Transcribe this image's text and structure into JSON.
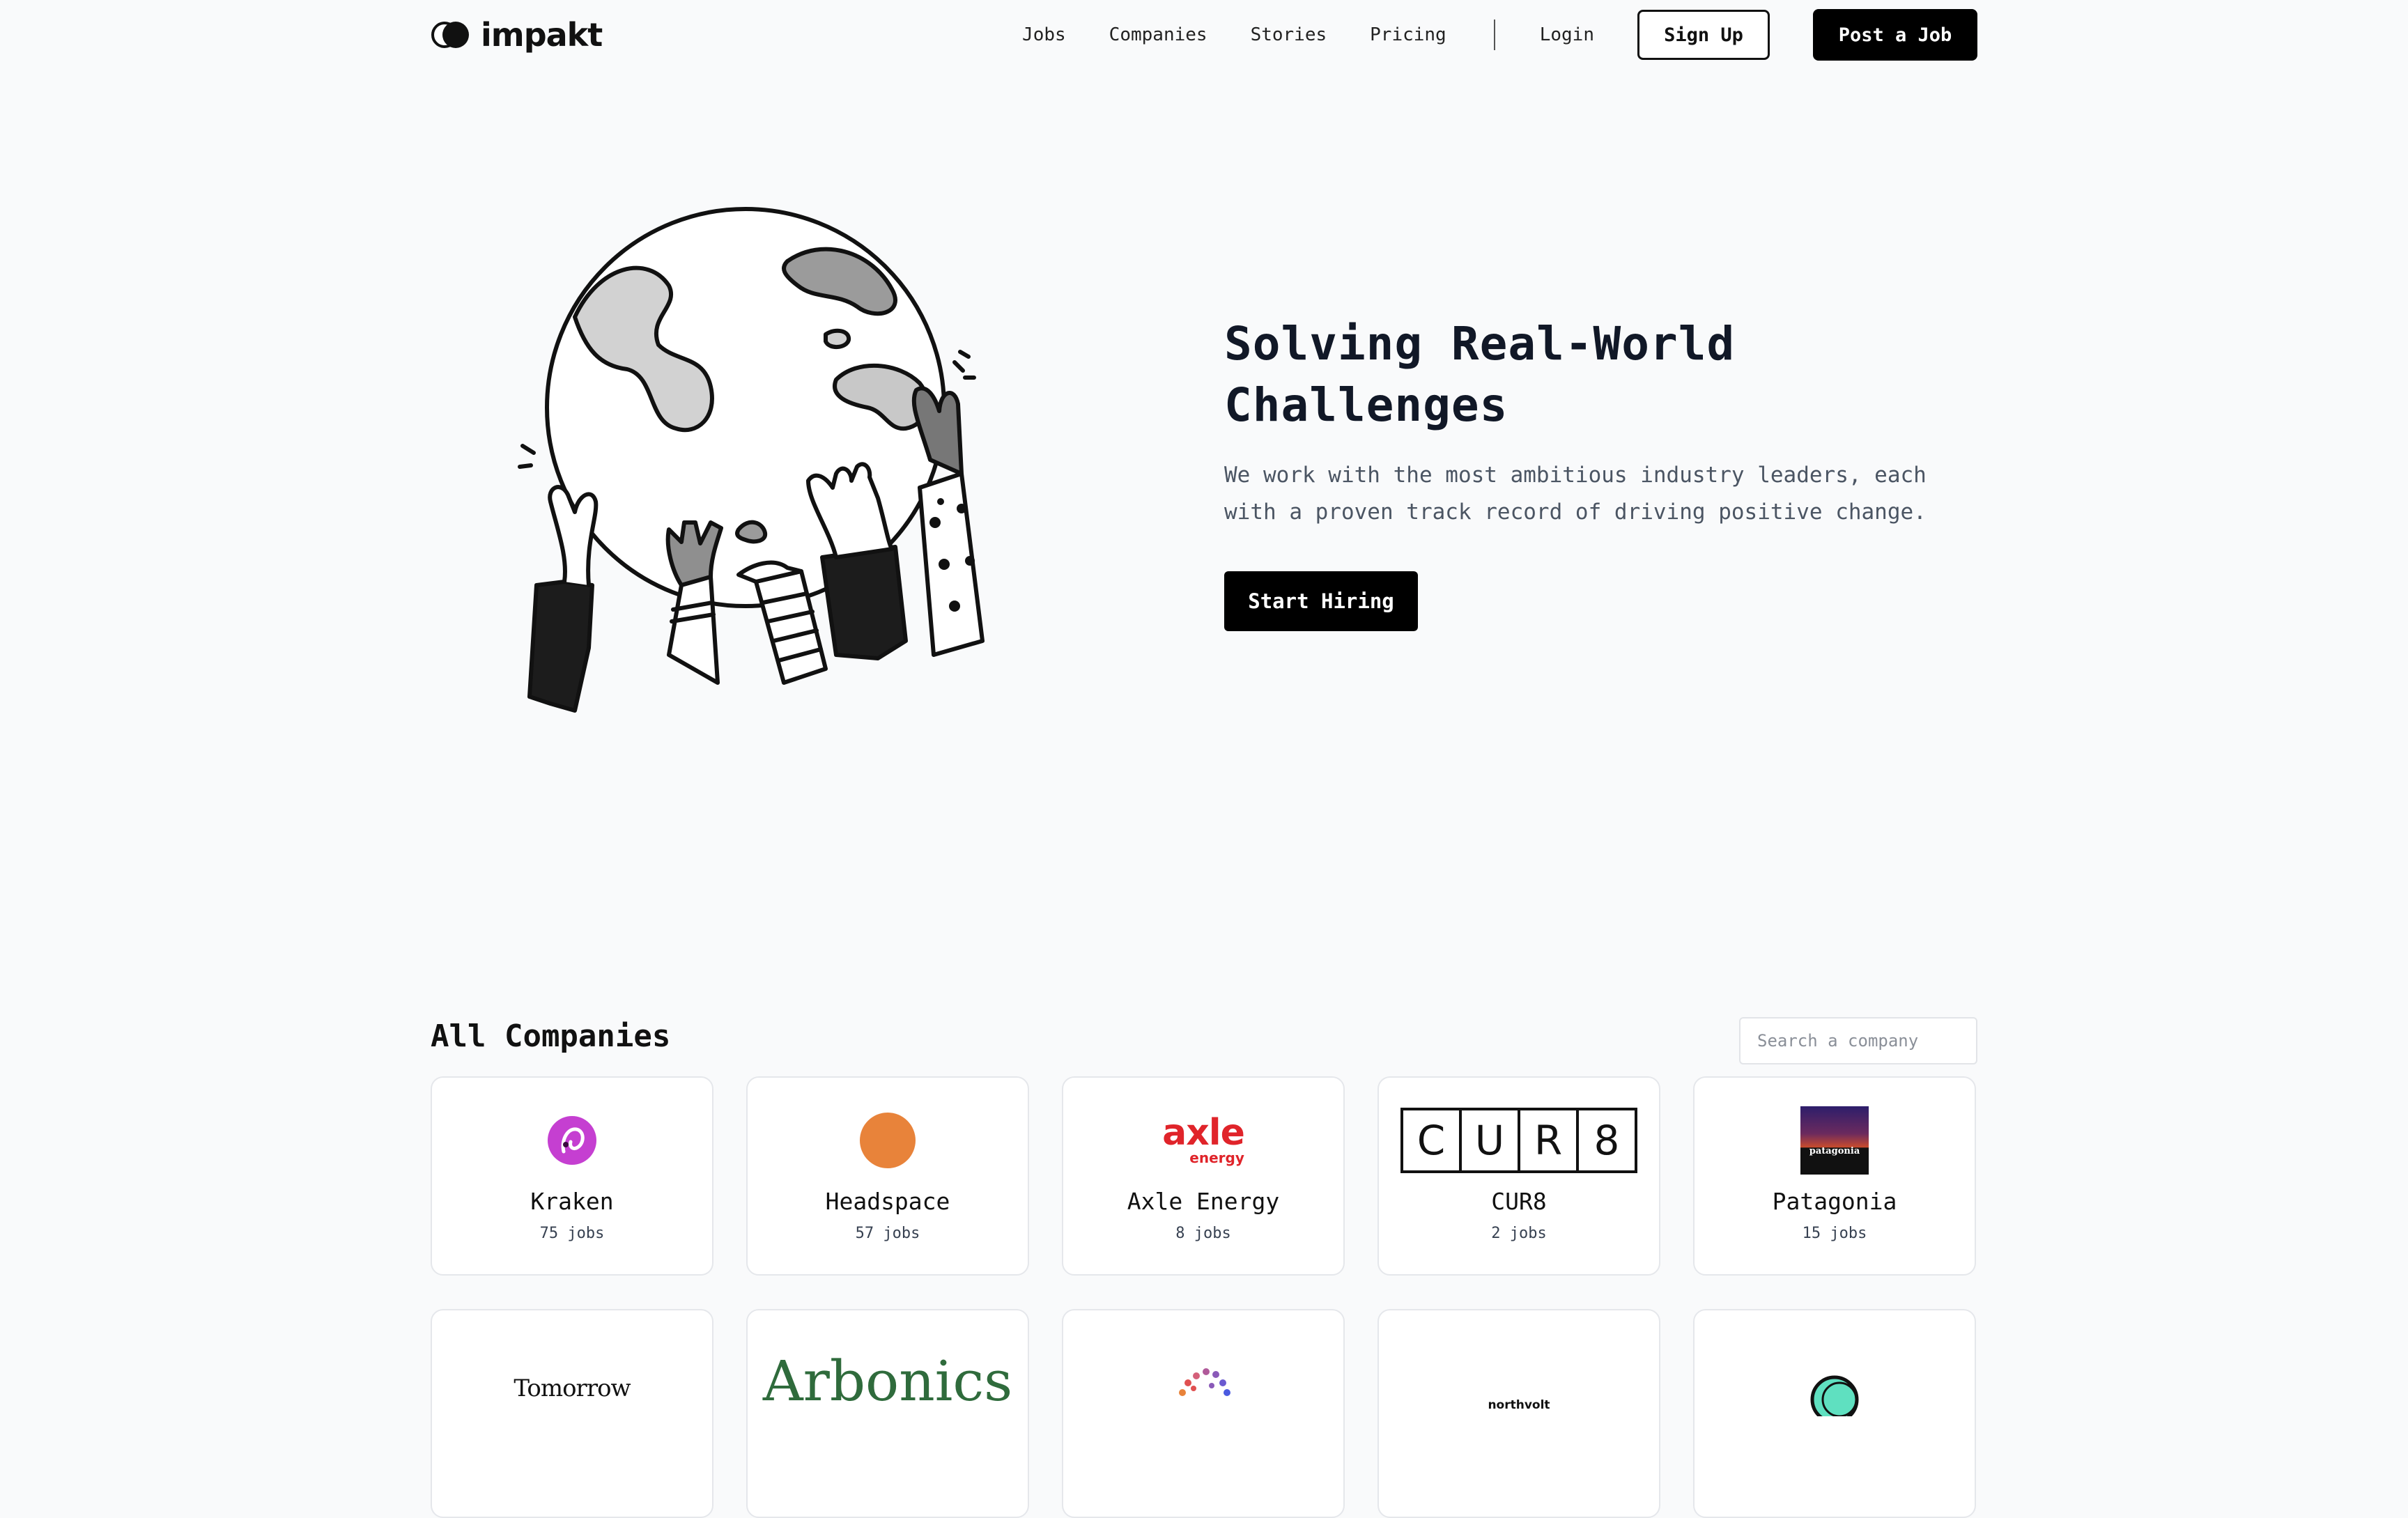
{
  "brand": {
    "name": "impakt"
  },
  "nav": {
    "links": [
      "Jobs",
      "Companies",
      "Stories",
      "Pricing"
    ],
    "login": "Login",
    "sign_up": "Sign Up",
    "post_job": "Post a Job"
  },
  "hero": {
    "title": "Solving Real-World Challenges",
    "subtitle": "We work with the most ambitious industry leaders, each with a proven track record of driving positive change.",
    "cta": "Start Hiring"
  },
  "companies": {
    "title": "All Companies",
    "search_placeholder": "Search a company",
    "items": [
      {
        "name": "Kraken",
        "jobs": "75 jobs"
      },
      {
        "name": "Headspace",
        "jobs": "57 jobs"
      },
      {
        "name": "Axle Energy",
        "jobs": "8 jobs"
      },
      {
        "name": "CUR8",
        "jobs": "2 jobs"
      },
      {
        "name": "Patagonia",
        "jobs": "15 jobs"
      }
    ],
    "partial_logos": [
      "Tomorrow",
      "Arbonics",
      "",
      "northvolt",
      ""
    ]
  },
  "logo_text": {
    "axle_main": "axle",
    "axle_sub": "energy",
    "cur8": [
      "C",
      "U",
      "R",
      "8"
    ],
    "patagonia": "patagonia"
  },
  "colors": {
    "kraken": "#c53fd1",
    "headspace": "#e8833a",
    "axle": "#e0242a",
    "patagonia_bg": "#2d1e6b",
    "arbonics": "#2f6b3c",
    "accent": "#000000"
  }
}
